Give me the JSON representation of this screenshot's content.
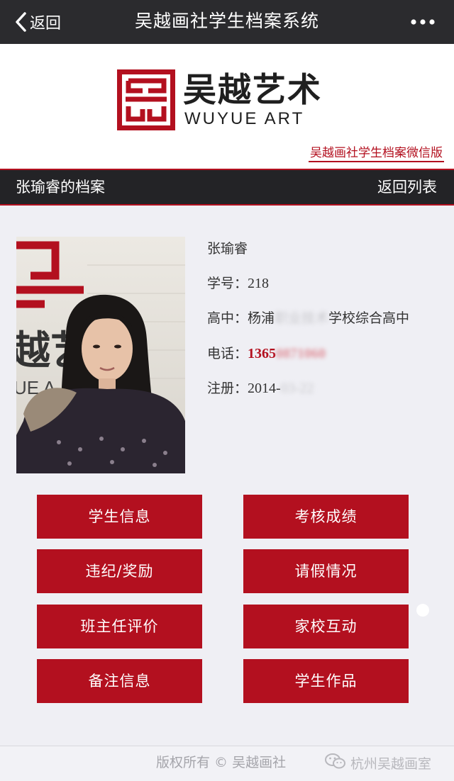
{
  "navbar": {
    "back_label": "返回",
    "title": "吴越画社学生档案系统",
    "more_icon": "more-dots-icon"
  },
  "banner": {
    "logo_cn": "吴越艺术",
    "logo_en": "WUYUE ART",
    "tagline": "吴越画社学生档案微信版"
  },
  "section": {
    "title": "张瑜睿的档案",
    "back_to_list": "返回列表"
  },
  "profile": {
    "name": "张瑜睿",
    "student_id_label": "学号：",
    "student_id": "218",
    "school_label": "高中：",
    "school_prefix": "杨浦",
    "school_hidden": "职业技术",
    "school_suffix": "学校综合高中",
    "phone_label": "电话：",
    "phone_prefix": "1365",
    "phone_hidden": "0871060",
    "register_label": "注册：",
    "register_prefix": "2014-",
    "register_hidden": "03-22"
  },
  "buttons": [
    {
      "label": "学生信息"
    },
    {
      "label": "考核成绩"
    },
    {
      "label": "违纪/奖励"
    },
    {
      "label": "请假情况"
    },
    {
      "label": "班主任评价"
    },
    {
      "label": "家校互动"
    },
    {
      "label": "备注信息"
    },
    {
      "label": "学生作品"
    }
  ],
  "footer": {
    "copyright": "版权所有 © 吴越画社",
    "watermark": "杭州吴越画室"
  },
  "colors": {
    "accent": "#b3101f",
    "navbar": "#2b2b2e",
    "background": "#efeff4"
  }
}
